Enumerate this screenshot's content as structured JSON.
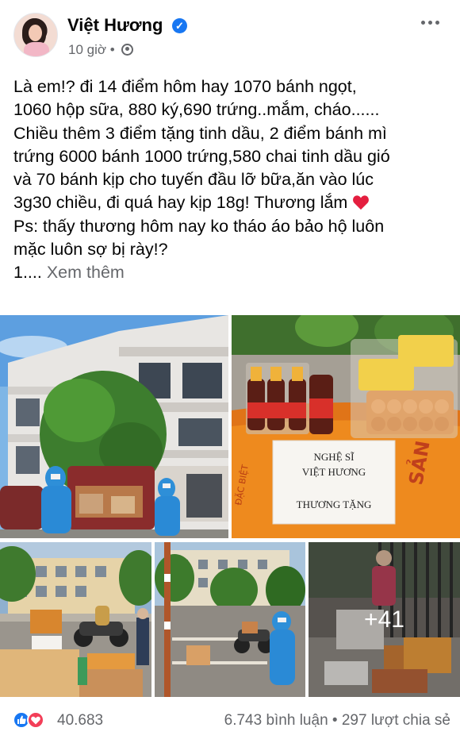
{
  "post": {
    "author": "Việt Hương",
    "time": "10 giờ",
    "separator": "•",
    "lines": [
      "Là em!? đi 14 điểm hôm hay 1070 bánh ngọt,",
      "1060 hộp sữa, 880 ký,690 trứng..mắm, cháo......",
      "Chiều thêm 3 điểm tặng tinh dầu, 2 điểm bánh mì",
      "trứng 6000 bánh 1000 trứng,580 chai tinh dầu gió",
      "và 70 bánh kịp cho tuyến đầu lỡ bữa,ăn vào lúc",
      "3g30 chiều, đi quá hay kịp 18g! Thương lắm",
      "Ps: thấy thương hôm nay ko tháo áo bảo hộ luôn",
      "mặc luôn sợ bị rày!?"
    ],
    "truncated_prefix": "1....",
    "see_more": "Xem thêm"
  },
  "photos": {
    "sign_lines": [
      "NGHỆ SĨ",
      "VIỆT HƯƠNG",
      "THƯƠNG TẶNG"
    ],
    "more_count": "+41"
  },
  "footer": {
    "reaction_count": "40.683",
    "comments": "6.743 bình luận",
    "dot": "•",
    "shares": "297 lượt chia sẻ"
  },
  "colors": {
    "accent": "#1877f2",
    "love": "#f33e58",
    "muted": "#65676b"
  },
  "icons": {
    "verified": "verified-badge-icon",
    "privacy": "globe-icon",
    "menu": "more-icon",
    "heart": "red-heart-icon"
  }
}
